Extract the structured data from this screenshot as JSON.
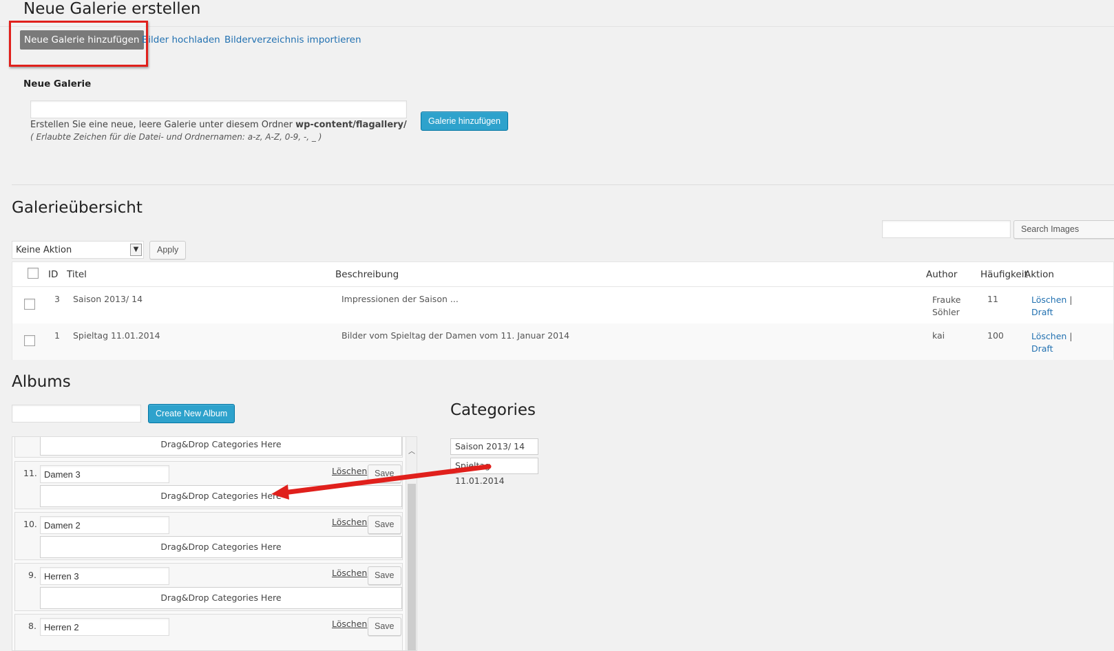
{
  "header": {
    "title": "Neue Galerie erstellen",
    "tabs": [
      {
        "label": "Neue Galerie hinzufügen",
        "active": true
      },
      {
        "label": "Bilder hochladen",
        "active": false
      },
      {
        "label": "Bilderverzeichnis importieren",
        "active": false
      }
    ]
  },
  "new_gallery": {
    "label": "Neue Galerie",
    "input_value": "",
    "help_text": "Erstellen Sie eine neue, leere Galerie unter diesem Ordner ",
    "help_path": "wp-content/flagallery/",
    "allowed_chars": "( Erlaubte Zeichen für die Datei- und Ordnernamen: a-z, A-Z, 0-9, -, _ )",
    "submit_label": "Galerie hinzufügen"
  },
  "overview": {
    "title": "Galerieübersicht",
    "search_value": "",
    "search_button": "Search Images",
    "bulk_action": "Keine Aktion",
    "apply_label": "Apply",
    "columns": {
      "id": "ID",
      "title": "Titel",
      "description": "Beschreibung",
      "author": "Author",
      "frequency": "Häufigkeit",
      "action": "Aktion"
    },
    "rows": [
      {
        "id": "3",
        "title": "Saison 2013/ 14",
        "description": "Impressionen der Saison ...",
        "author": "Frauke Söhler",
        "frequency": "11",
        "action_delete": "Löschen",
        "action_sep": "|",
        "action_draft": "Draft"
      },
      {
        "id": "1",
        "title": "Spieltag 11.01.2014",
        "description": "Bilder vom Spieltag der Damen vom 11. Januar 2014",
        "author": "kai",
        "frequency": "100",
        "action_delete": "Löschen",
        "action_sep": "|",
        "action_draft": "Draft"
      }
    ]
  },
  "albums": {
    "title": "Albums",
    "new_album_value": "",
    "create_label": "Create New Album",
    "dropzone_label": "Drag&Drop Categories Here",
    "delete_label": "Löschen",
    "save_label": "Save",
    "items": [
      {
        "num": "11.",
        "name": "Damen 3"
      },
      {
        "num": "10.",
        "name": "Damen 2"
      },
      {
        "num": "9.",
        "name": "Herren 3"
      },
      {
        "num": "8.",
        "name": "Herren 2"
      }
    ]
  },
  "categories": {
    "title": "Categories",
    "items": [
      "Saison 2013/ 14",
      "Spieltag 11.01.2014"
    ]
  },
  "colors": {
    "primary_button": "#2ea2cc",
    "link": "#2271b1",
    "annotation": "#e0201c",
    "active_tab": "#7a7a7a"
  }
}
